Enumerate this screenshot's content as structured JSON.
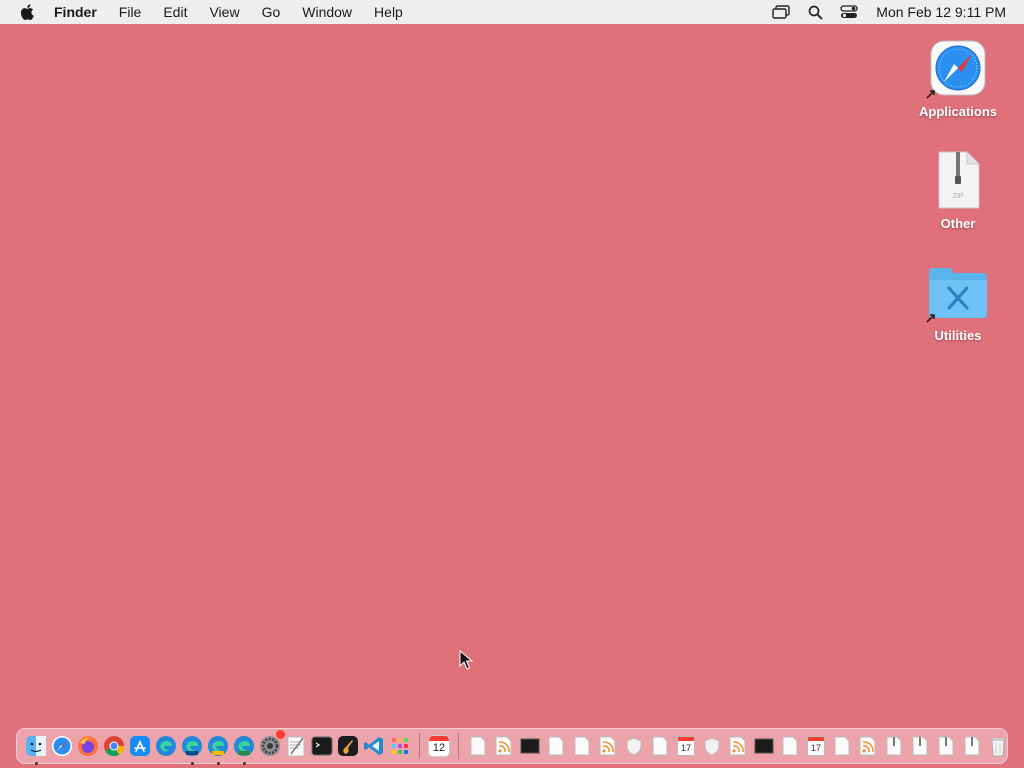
{
  "menubar": {
    "apple_icon": "apple-logo-icon",
    "app_name": "Finder",
    "menus": [
      "File",
      "Edit",
      "View",
      "Go",
      "Window",
      "Help"
    ],
    "status_icons": [
      "screen-mirroring-icon",
      "spotlight-search-icon",
      "control-center-icon"
    ],
    "clock": "Mon Feb 12  9:11 PM"
  },
  "desktop": {
    "background_color": "#e0707a",
    "icons": [
      {
        "label": "Applications",
        "icon": "safari-compass-icon"
      },
      {
        "label": "Other",
        "icon": "zip-archive-icon"
      },
      {
        "label": "Utilities",
        "icon": "utilities-folder-icon"
      }
    ]
  },
  "dock": {
    "apps": [
      "finder-icon",
      "safari-icon",
      "firefox-icon",
      "chrome-icon",
      "app-store-icon",
      "edge-icon",
      "edge-beta-icon",
      "edge-canary-icon",
      "edge-dev-icon",
      "system-settings-icon",
      "textedit-icon",
      "terminal-icon",
      "garageband-icon",
      "vscode-icon",
      "launchpad-icon"
    ],
    "system_settings_badge": "1",
    "calendar_day": "12",
    "recents": [
      "document-icon",
      "rss-feed-icon",
      "terminal-window-icon",
      "document-icon",
      "document-icon",
      "rss-feed-icon",
      "shield-icon",
      "document-icon",
      "calendar-file-icon",
      "shield-icon",
      "rss-feed-icon",
      "terminal-window-icon",
      "document-icon",
      "calendar-file-icon",
      "document-icon",
      "rss-feed-icon",
      "zip-file-icon",
      "zip-file-icon",
      "zip-file-icon",
      "zip-file-icon"
    ],
    "recent_calendar_day": "17",
    "trash": "trash-icon"
  }
}
